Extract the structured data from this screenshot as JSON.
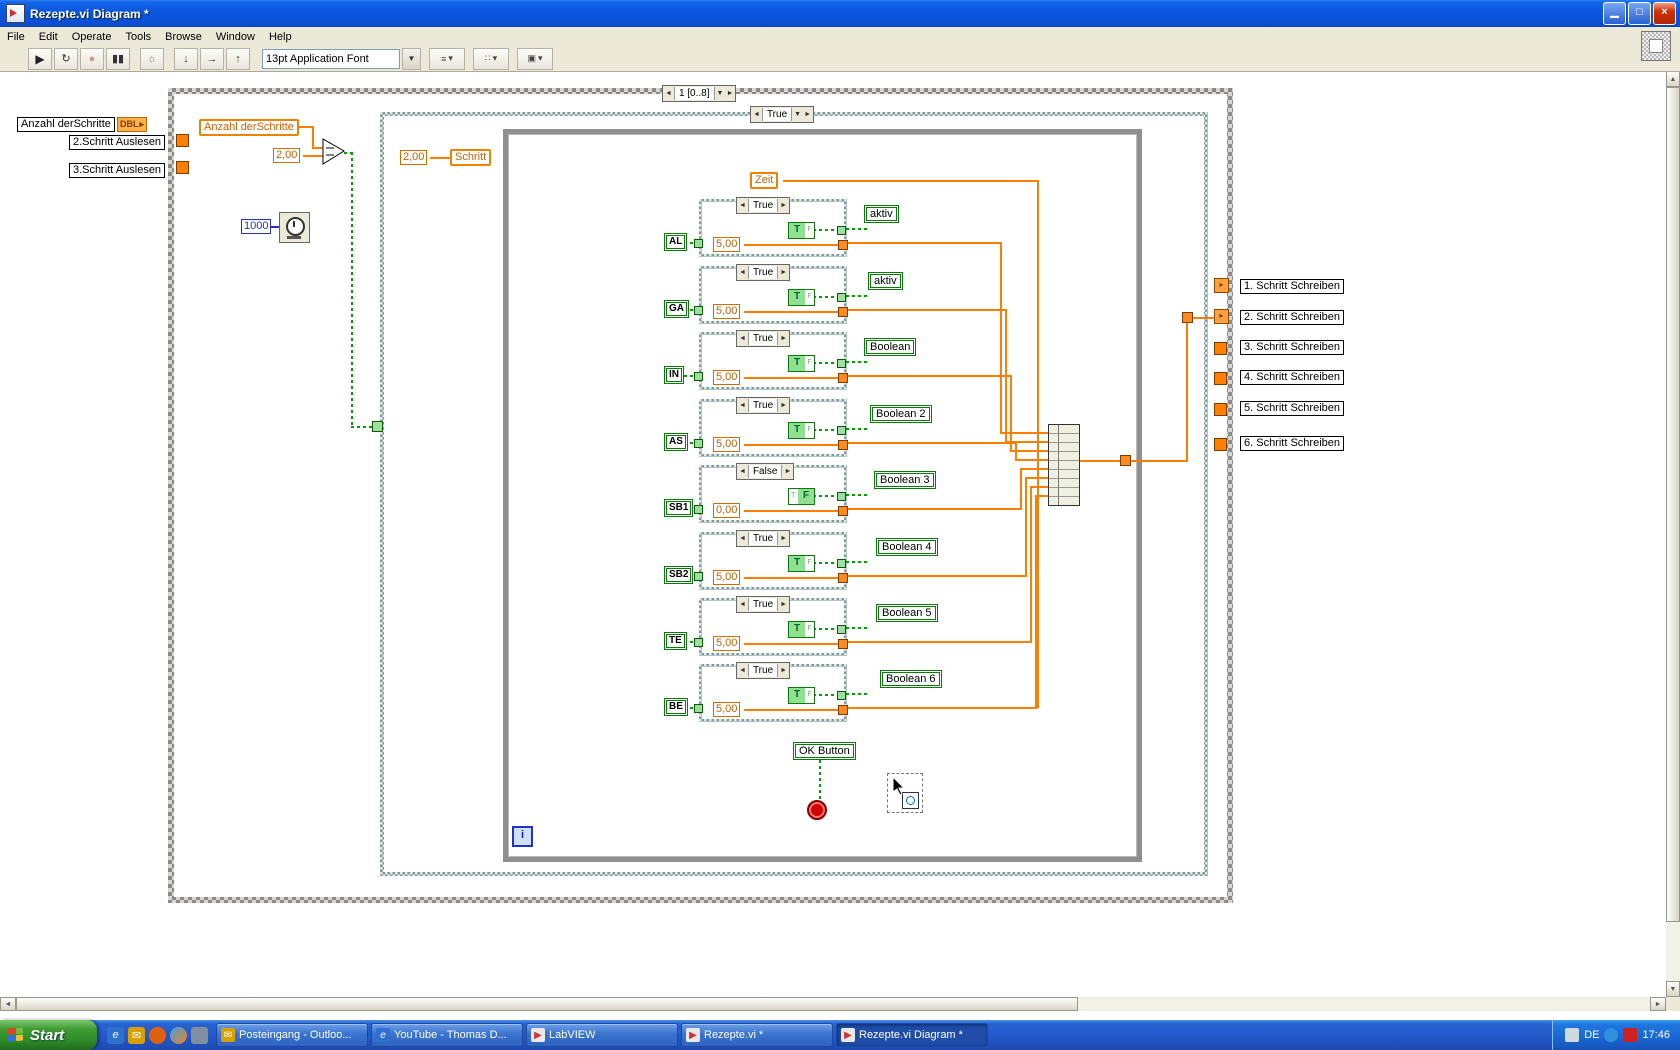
{
  "titlebar": {
    "title": "Rezepte.vi Diagram *"
  },
  "menu": {
    "items": [
      {
        "label": "File"
      },
      {
        "label": "Edit"
      },
      {
        "label": "Operate"
      },
      {
        "label": "Tools"
      },
      {
        "label": "Browse"
      },
      {
        "label": "Window"
      },
      {
        "label": "Help"
      }
    ]
  },
  "toolbar": {
    "font_name": "13pt Application Font"
  },
  "icons": {
    "run": "▶",
    "run_continuous": "↻",
    "abort": "●",
    "pause": "▮▮",
    "highlight": "☼",
    "step_into": "↓",
    "step_over": "→",
    "step_out": "↑",
    "left": "◄",
    "right": "►",
    "down": "▼",
    "up": "▲",
    "small_right": "▸",
    "minimize": "▁",
    "maximize": "□",
    "close": "×",
    "dropdown": "▾",
    "align": "≡",
    "distribute": "∷",
    "reorder": "▣",
    "envelope": "✉",
    "ie": "e",
    "play": "▶",
    "arrow": "➤"
  },
  "diagram": {
    "anzahl_label": "Anzahl derSchritte",
    "dbl_badge": "DBL",
    "read_step2": "2.Schritt Auslesen",
    "read_step3": "3.Schritt Auslesen",
    "anzahl_terminal": "Anzahl derSchritte",
    "count_value": "2,00",
    "wait_value": "1000",
    "sequence_selector": "1 [0..8]",
    "case_selector": "True",
    "step_value": "2,00",
    "step_terminal": "Schritt",
    "zeit_terminal": "Zeit",
    "iteration_terminal": "i",
    "ok_button": "OK Button",
    "bool_true_char": "T",
    "bool_false_char": "F"
  },
  "cases": [
    {
      "terminal": "AL",
      "selector": "True",
      "value": "5,00",
      "indicator": "aktiv"
    },
    {
      "terminal": "GA",
      "selector": "True",
      "value": "5,00",
      "indicator": "aktiv"
    },
    {
      "terminal": "IN",
      "selector": "True",
      "value": "5,00",
      "indicator": "Boolean"
    },
    {
      "terminal": "AS",
      "selector": "True",
      "value": "5,00",
      "indicator": "Boolean 2"
    },
    {
      "terminal": "SB1",
      "selector": "False",
      "value": "0,00",
      "indicator": "Boolean 3"
    },
    {
      "terminal": "SB2",
      "selector": "True",
      "value": "5,00",
      "indicator": "Boolean 4"
    },
    {
      "terminal": "TE",
      "selector": "True",
      "value": "5,00",
      "indicator": "Boolean 5"
    },
    {
      "terminal": "BE",
      "selector": "True",
      "value": "5,00",
      "indicator": "Boolean 6"
    }
  ],
  "write_steps": [
    {
      "label": "1. Schritt Schreiben"
    },
    {
      "label": "2. Schritt Schreiben"
    },
    {
      "label": "3. Schritt Schreiben"
    },
    {
      "label": "4. Schritt Schreiben"
    },
    {
      "label": "5. Schritt Schreiben"
    },
    {
      "label": "6. Schritt Schreiben"
    }
  ],
  "taskbar": {
    "start_label": "Start",
    "tasks": [
      {
        "label": "Posteingang - Outloo..."
      },
      {
        "label": "YouTube - Thomas D..."
      },
      {
        "label": "LabVIEW"
      },
      {
        "label": "Rezepte.vi *"
      },
      {
        "label": "Rezepte.vi Diagram *"
      }
    ],
    "language": "DE",
    "time": "17:46"
  },
  "colors": {
    "wire_orange": "#ff7d00",
    "wire_green": "#00a000",
    "terminal_green": "#0a7a0a",
    "numeric_orange": "#d06f00"
  }
}
